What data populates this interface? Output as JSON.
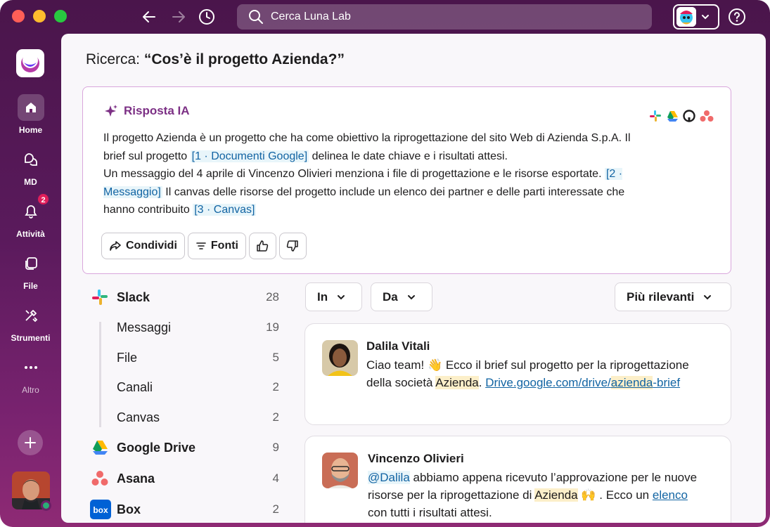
{
  "search": {
    "placeholder": "Cerca Luna Lab"
  },
  "rail": {
    "items": [
      {
        "label": "Home"
      },
      {
        "label": "MD"
      },
      {
        "label": "Attività",
        "badge": "2"
      },
      {
        "label": "File"
      },
      {
        "label": "Strumenti"
      },
      {
        "label": "Altro"
      }
    ]
  },
  "query": {
    "prefix": "Ricerca:",
    "text": "“Cos’è il progetto Azienda?”"
  },
  "ai": {
    "title": "Risposta IA",
    "p1": "Il progetto Azienda è un progetto che ha come obiettivo la riprogettazione del sito Web di Azienda S.p.A. Il brief sul progetto ",
    "c1": "[1 · Documenti Google]",
    "p2": " delinea le date chiave e i risultati attesi.",
    "p3": "Un messaggio del 4 aprile di Vincenzo Olivieri menziona i file di progettazione e le risorse esportate. ",
    "c2": "[2 · Messaggio]",
    "p4": " Il canvas delle risorse del progetto include un elenco dei partner e delle parti interessate che hanno contribuito ",
    "c3": "[3 · Canvas]",
    "share": "Condividi",
    "sources": "Fonti",
    "source_icons": [
      "slack-icon",
      "google-drive-icon",
      "github-icon",
      "asana-icon"
    ]
  },
  "sources_list": [
    {
      "name": "Slack",
      "count": "28",
      "icon": "slack-icon"
    },
    {
      "name": "Messaggi",
      "count": "19"
    },
    {
      "name": "File",
      "count": "5"
    },
    {
      "name": "Canali",
      "count": "2"
    },
    {
      "name": "Canvas",
      "count": "2"
    },
    {
      "name": "Google Drive",
      "count": "9",
      "icon": "google-drive-icon"
    },
    {
      "name": "Asana",
      "count": "4",
      "icon": "asana-icon"
    },
    {
      "name": "Box",
      "count": "2",
      "icon": "box-icon"
    }
  ],
  "filters": {
    "in": "In",
    "from": "Da",
    "sort": "Più rilevanti"
  },
  "results": [
    {
      "name": "Dalila Vitali",
      "t1": "Ciao team! ",
      "emoji1": "👋",
      "t2": " Ecco il brief sul progetto per la riprogettazione della società ",
      "hl1": "Azienda",
      "t3": ". ",
      "link1": "Drive.google.com/drive/",
      "link_hl": "azienda",
      "link2": "-brief"
    },
    {
      "name": "Vincenzo Olivieri",
      "mention": "@Dalila",
      "t1": " abbiamo appena ricevuto l’approvazione per le nuove risorse per la riprogettazione di ",
      "hl1": "Azienda",
      "t2": " ",
      "emoji1": "🙌",
      "t3": " . Ecco un ",
      "link1": "elenco",
      "t4": " con tutti i risultati attesi."
    }
  ],
  "colors": {
    "aubergine": "#4a154b",
    "ai_purple": "#7c3085",
    "link": "#1264a3",
    "badge": "#e01e5a"
  }
}
